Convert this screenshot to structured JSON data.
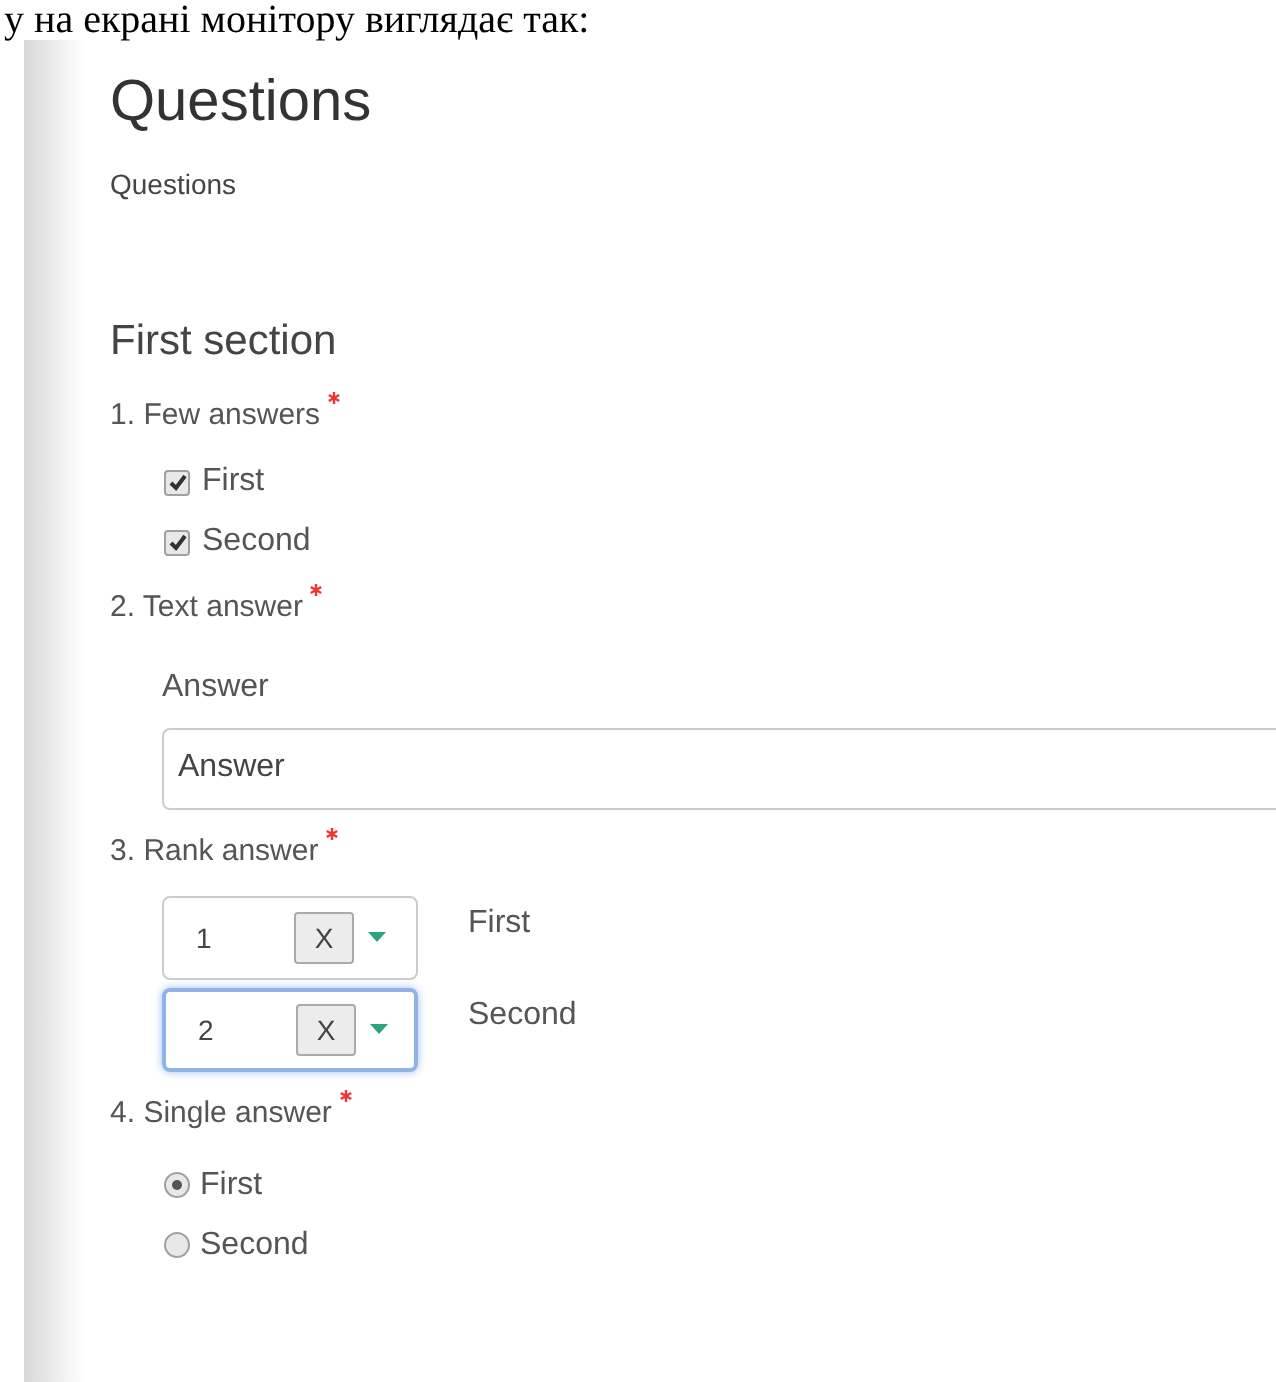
{
  "caption": "у на екрані монітору виглядає так:",
  "title": "Questions",
  "subtitle": "Questions",
  "section": "First section",
  "questions": [
    {
      "kind": "checkbox",
      "number": "1.",
      "label": "Few answers",
      "required": true,
      "options": [
        {
          "label": "First",
          "checked": true
        },
        {
          "label": "Second",
          "checked": true
        }
      ]
    },
    {
      "kind": "text",
      "number": "2.",
      "label": "Text answer",
      "required": true,
      "field_label": "Answer",
      "value": "Answer"
    },
    {
      "kind": "rank",
      "number": "3.",
      "label": "Rank answer",
      "required": true,
      "items": [
        {
          "value": "1",
          "clear": "X",
          "label": "First",
          "focused": false
        },
        {
          "value": "2",
          "clear": "X",
          "label": "Second",
          "focused": true
        }
      ]
    },
    {
      "kind": "radio",
      "number": "4.",
      "label": "Single answer",
      "required": true,
      "options": [
        {
          "label": "First",
          "selected": true
        },
        {
          "label": "Second",
          "selected": false
        }
      ]
    }
  ]
}
